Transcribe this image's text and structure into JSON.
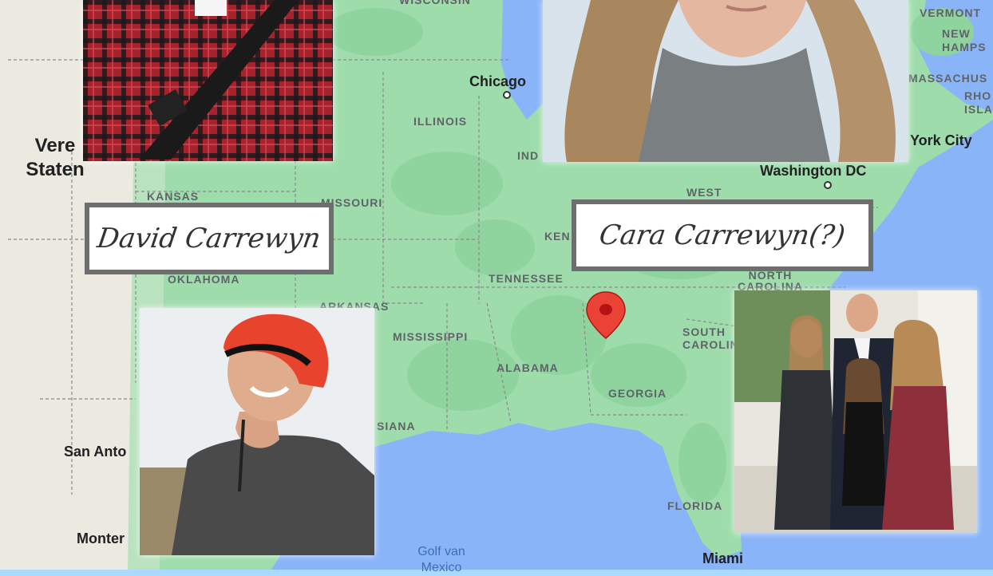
{
  "map": {
    "land_color": "#9fdcac",
    "land_dark": "#8fd39f",
    "west_land_color": "#f1efe9",
    "water_color": "#8ab4f8",
    "state_labels": [
      "WISCONSIN",
      "ILLINOIS",
      "IND",
      "KANSAS",
      "MISSOURI",
      "KEN",
      "WEST",
      "OKLAHOMA",
      "TENNESSEE",
      "NORTH CAROLINA",
      "ARKANSAS",
      "MISSISSIPPI",
      "SOUTH CAROLINA",
      "ALABAMA",
      "GEORGIA",
      "SIANA",
      "FLORIDA",
      "VERMONT",
      "NEW HAMPS",
      "MASSACHUS",
      "RHO ISLA"
    ],
    "city_labels": [
      "Chicago",
      "Washington DC",
      "York City",
      "San Anto",
      "Monter",
      "Miami"
    ],
    "country_label": "Vere Staten",
    "sea_label": "Golf van Mexico",
    "pin_color": "#ea4335",
    "pin_icon": "map-pin-icon"
  },
  "people": {
    "david": {
      "name": "David Carrewyn"
    },
    "cara": {
      "name": "Cara Carrewyn(?)"
    }
  }
}
